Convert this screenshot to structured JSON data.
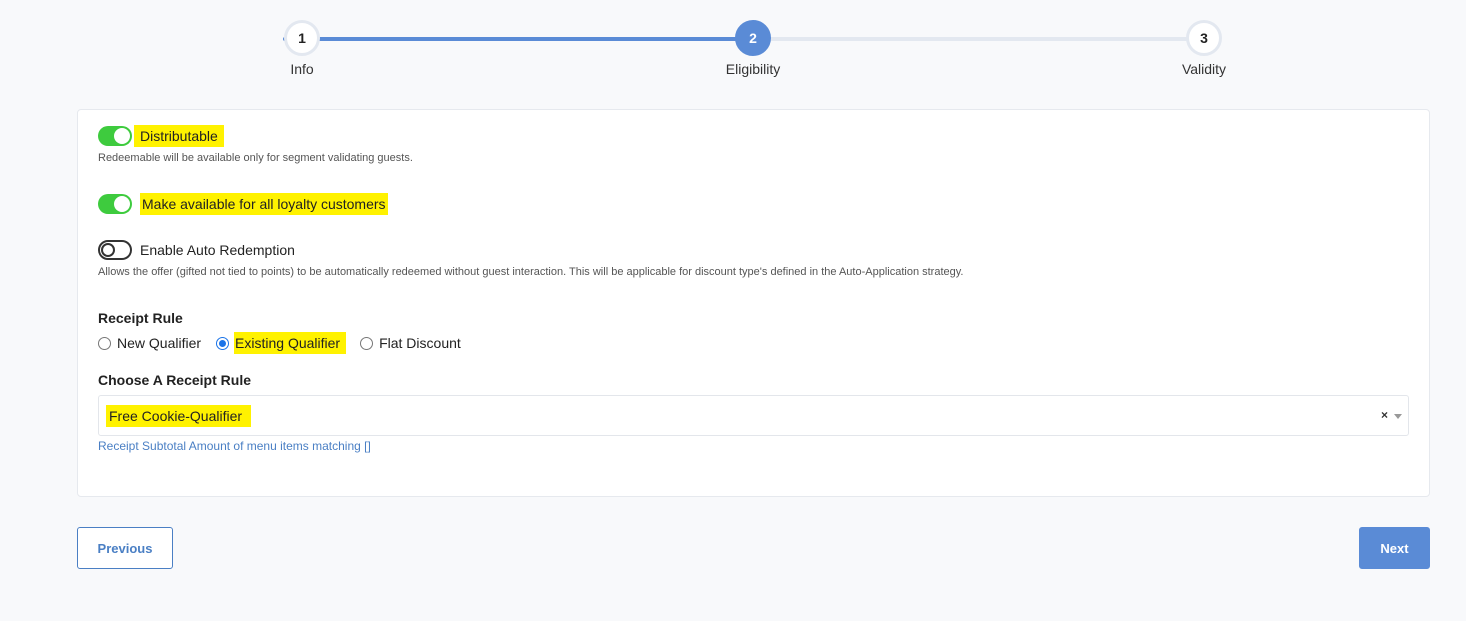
{
  "stepper": {
    "steps": [
      {
        "number": "1",
        "label": "Info",
        "state": "done"
      },
      {
        "number": "2",
        "label": "Eligibility",
        "state": "active"
      },
      {
        "number": "3",
        "label": "Validity",
        "state": "pending"
      }
    ],
    "progress_color": "#5a8bd6"
  },
  "toggles": {
    "distributable": {
      "label": "Distributable",
      "enabled": true,
      "help": "Redeemable will be available only for segment validating guests."
    },
    "all_loyalty": {
      "label": "Make available for all loyalty customers",
      "enabled": true
    },
    "auto_redemption": {
      "label": "Enable Auto Redemption",
      "enabled": false,
      "help": "Allows the offer (gifted not tied to points) to be automatically redeemed without guest interaction. This will be applicable for discount type's defined in the Auto-Application strategy."
    }
  },
  "receipt_rule": {
    "title": "Receipt Rule",
    "options": [
      "New Qualifier",
      "Existing Qualifier",
      "Flat Discount"
    ],
    "selected": "Existing Qualifier"
  },
  "choose_rule": {
    "title": "Choose A Receipt Rule",
    "selected_value": "Free Cookie-Qualifier",
    "clear_glyph": "×",
    "description": "Receipt Subtotal Amount of menu items matching []"
  },
  "buttons": {
    "previous": "Previous",
    "next": "Next"
  },
  "colors": {
    "highlight": "#fff200",
    "toggle_on": "#3ecb3e",
    "accent": "#5a8bd6",
    "link": "#4a7fc4"
  }
}
